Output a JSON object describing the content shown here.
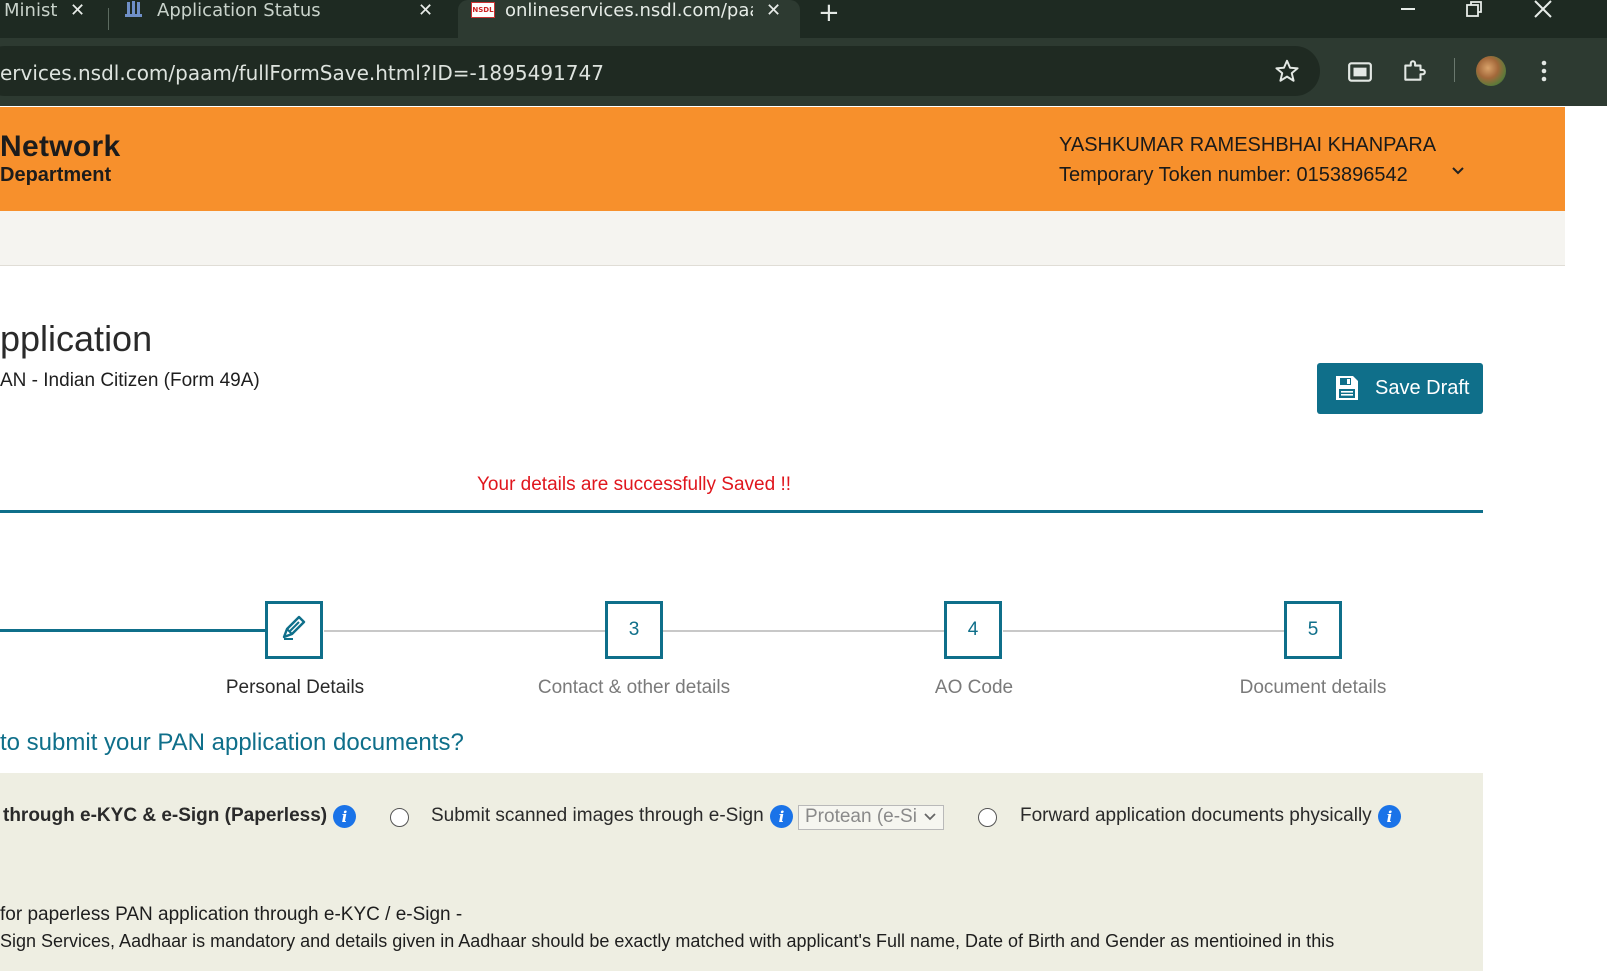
{
  "browser": {
    "tabs": [
      {
        "title": "Minist",
        "active": false
      },
      {
        "title": "Application Status",
        "active": false
      },
      {
        "title": "onlineservices.nsdl.com/paam/f",
        "active": true
      }
    ],
    "favicon_nsdl_text": "NSDL",
    "close_glyph": "✕",
    "new_tab_glyph": "+",
    "url": "ervices.nsdl.com/paam/fullFormSave.html?ID=-1895491747",
    "icons": [
      "star-icon",
      "cast-icon",
      "extensions-icon",
      "profile-avatar",
      "menu-icon"
    ]
  },
  "header": {
    "logo_line1": "Network",
    "logo_line2": "Department",
    "user_name": "YASHKUMAR RAMESHBHAI KHANPARA",
    "token": "Temporary Token number: 0153896542",
    "brand_color": "#f7902c"
  },
  "page": {
    "title": "pplication",
    "subtitle": "AN - Indian Citizen (Form 49A)",
    "save_draft_label": "Save Draft",
    "success_message": "Your details are successfully Saved !!",
    "accent_color": "#0f6f8a"
  },
  "steps": [
    {
      "label": "Personal Details",
      "marker": "",
      "status": "current"
    },
    {
      "label": "Contact & other details",
      "marker": "3",
      "status": "pending"
    },
    {
      "label": "AO Code",
      "marker": "4",
      "status": "pending"
    },
    {
      "label": "Document details",
      "marker": "5",
      "status": "pending"
    }
  ],
  "question": "to submit your PAN application documents?",
  "options": {
    "option1_label": "through e-KYC & e-Sign (Paperless)",
    "option2_label": "Submit scanned images through e-Sign",
    "option2_select_value": "Protean (e-Si",
    "option3_label": "Forward application documents physically",
    "info_glyph": "i"
  },
  "notes": {
    "line1": "for paperless PAN application through e-KYC / e-Sign -",
    "line2": "Sign Services, Aadhaar is mandatory and details given in Aadhaar should be exactly matched with applicant's Full name, Date of Birth and Gender as mentioined in this"
  }
}
